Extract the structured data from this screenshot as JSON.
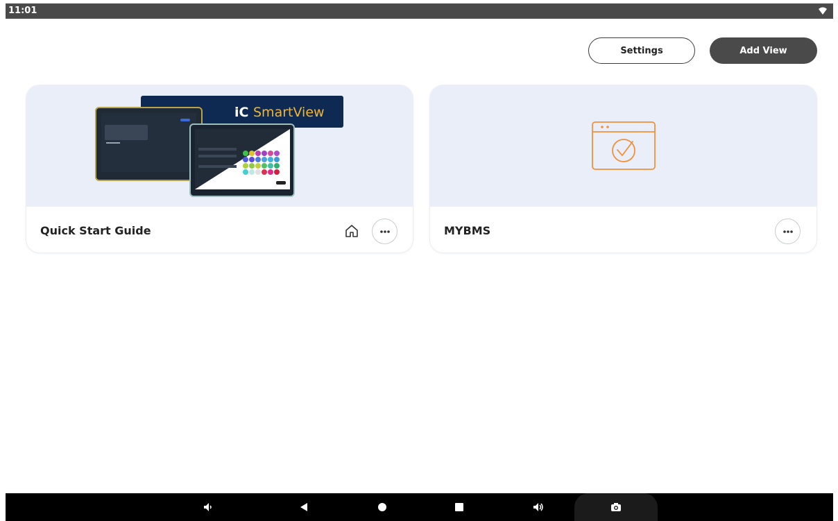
{
  "status_bar": {
    "time": "11:01",
    "wifi_icon": "wifi-icon"
  },
  "header": {
    "settings_label": "Settings",
    "add_view_label": "Add View"
  },
  "cards": [
    {
      "title": "Quick Start Guide",
      "thumbnail_brand": {
        "prefix": "iC",
        "name": "SmartView"
      },
      "home_icon": "home-icon",
      "more_icon": "more-icon"
    },
    {
      "title": "MYBMS",
      "thumbnail_icon": "browser-check-icon",
      "more_icon": "more-icon"
    }
  ],
  "navbar": {
    "icons": [
      "volume-down-icon",
      "back-icon",
      "home-circle-icon",
      "recents-icon",
      "volume-up-icon",
      "camera-icon"
    ]
  },
  "colors": {
    "accent_orange": "#f0913a",
    "card_bg": "#e9eef8",
    "dark_button": "#4a4a4a"
  }
}
